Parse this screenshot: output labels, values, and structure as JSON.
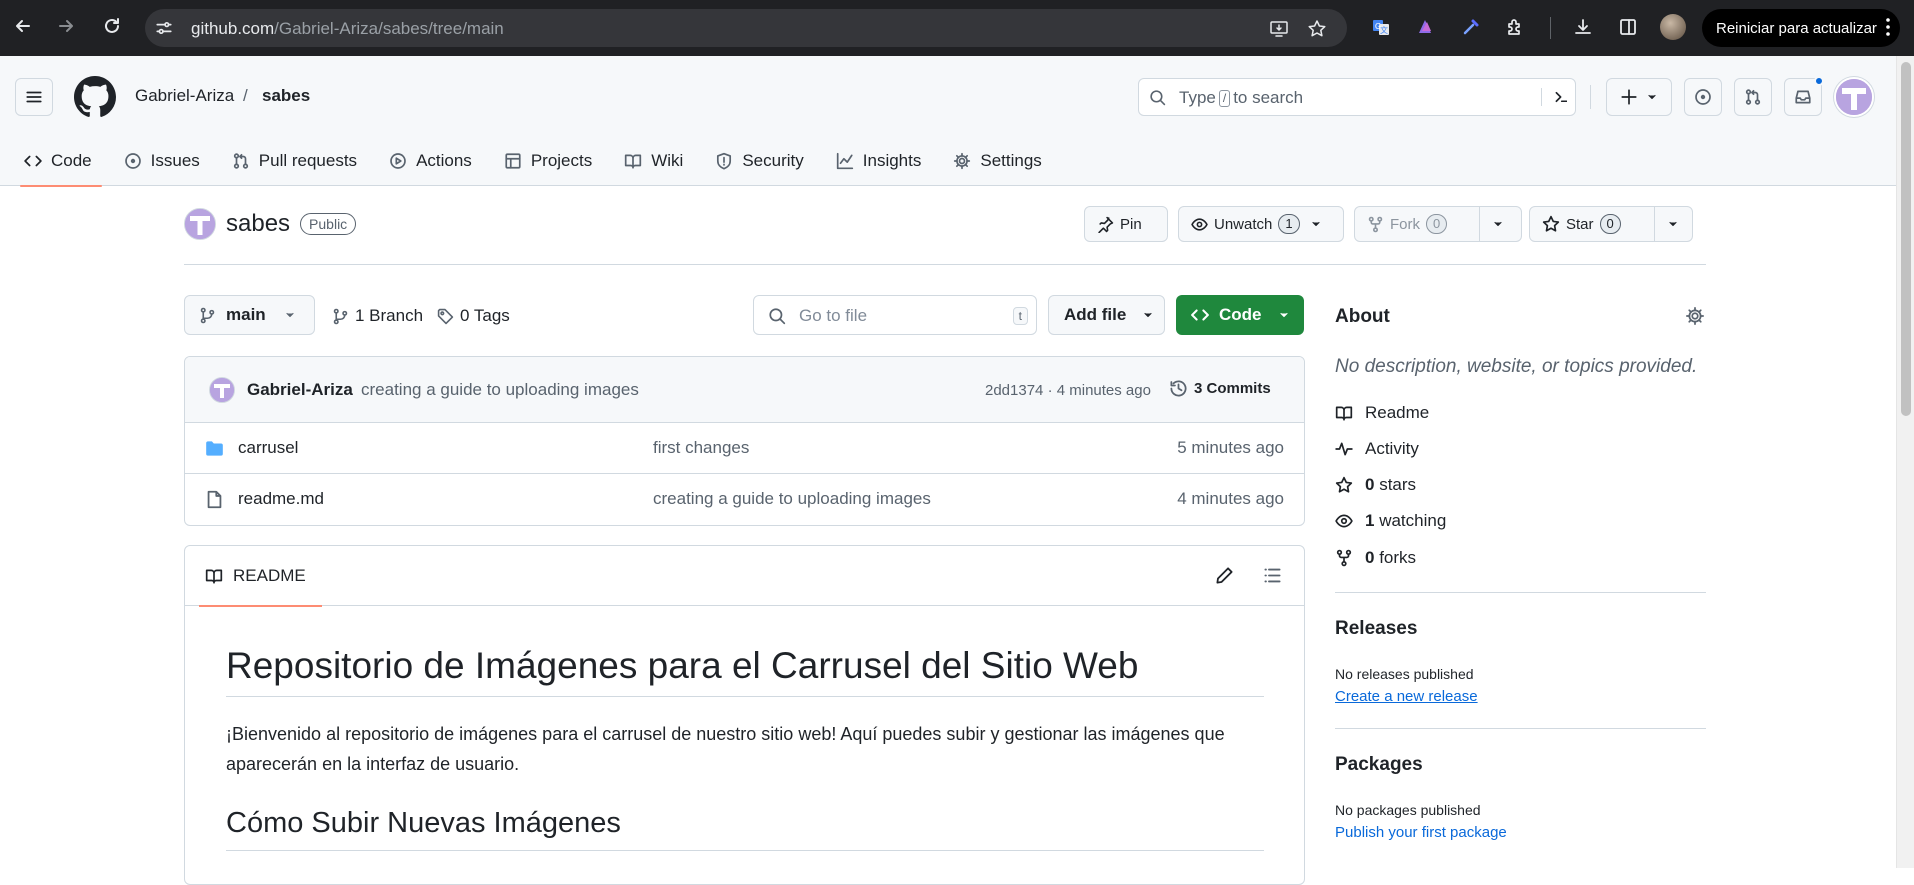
{
  "browser": {
    "url_host": "github.com",
    "url_path": "/Gabriel-Ariza/sabes/tree/main",
    "update_label": "Reiniciar para actualizar"
  },
  "header": {
    "owner": "Gabriel-Ariza",
    "separator": "/",
    "repo": "sabes",
    "search": {
      "pre": "Type",
      "key": "/",
      "post": "to search"
    }
  },
  "tabs": [
    {
      "label": "Code",
      "icon": "code-icon",
      "active": true
    },
    {
      "label": "Issues",
      "icon": "issue-icon"
    },
    {
      "label": "Pull requests",
      "icon": "pull-request-icon"
    },
    {
      "label": "Actions",
      "icon": "play-icon"
    },
    {
      "label": "Projects",
      "icon": "table-icon"
    },
    {
      "label": "Wiki",
      "icon": "book-icon"
    },
    {
      "label": "Security",
      "icon": "shield-icon"
    },
    {
      "label": "Insights",
      "icon": "graph-icon"
    },
    {
      "label": "Settings",
      "icon": "gear-icon"
    }
  ],
  "repo": {
    "name": "sabes",
    "visibility": "Public",
    "pin_label": "Pin",
    "unwatch_label": "Unwatch",
    "watch_count": "1",
    "fork_label": "Fork",
    "fork_count": "0",
    "star_label": "Star",
    "star_count": "0"
  },
  "toolbar": {
    "branch": "main",
    "branches": "1 Branch",
    "tags": "0 Tags",
    "goto_placeholder": "Go to file",
    "goto_key": "t",
    "add_file": "Add file",
    "code": "Code"
  },
  "commit": {
    "author": "Gabriel-Ariza",
    "message": "creating a guide to uploading images",
    "sha_time": "2dd1374 · 4 minutes ago",
    "commits": "3 Commits"
  },
  "files": [
    {
      "name": "carrusel",
      "type": "folder",
      "message": "first changes",
      "age": "5 minutes ago"
    },
    {
      "name": "readme.md",
      "type": "file",
      "message": "creating a guide to uploading images",
      "age": "4 minutes ago"
    }
  ],
  "readme": {
    "tab": "README",
    "h1": "Repositorio de Imágenes para el Carrusel del Sitio Web",
    "intro": "¡Bienvenido al repositorio de imágenes para el carrusel de nuestro sitio web! Aquí puedes subir y gestionar las imágenes que aparecerán en la interfaz de usuario.",
    "h2": "Cómo Subir Nuevas Imágenes"
  },
  "about": {
    "title": "About",
    "description": "No description, website, or topics provided.",
    "readme": "Readme",
    "activity": "Activity",
    "stars_n": "0",
    "stars": "stars",
    "watching_n": "1",
    "watching": "watching",
    "forks_n": "0",
    "forks": "forks"
  },
  "releases": {
    "title": "Releases",
    "empty": "No releases published",
    "link": "Create a new release"
  },
  "packages": {
    "title": "Packages",
    "empty": "No packages published",
    "link": "Publish your first package"
  },
  "colors": {
    "accent_green": "#1f883d",
    "link_blue": "#0969da",
    "tab_underline": "#fd8c73",
    "folder_blue": "#54aeff"
  }
}
